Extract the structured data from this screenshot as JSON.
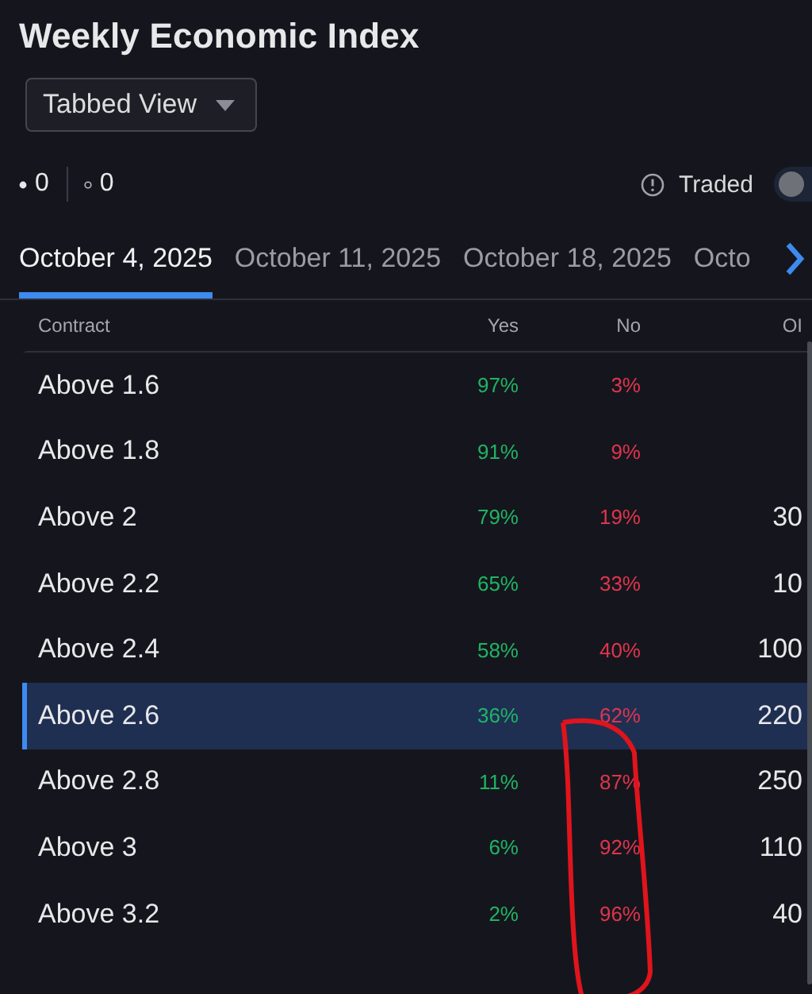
{
  "title": "Weekly Economic Index",
  "view_select": {
    "value": "Tabbed View"
  },
  "counts": [
    {
      "kind": "filled",
      "value": "0"
    },
    {
      "kind": "hollow",
      "value": "0"
    }
  ],
  "traded_toggle": {
    "label": "Traded",
    "on": false
  },
  "tabs": [
    {
      "label": "October 4, 2025",
      "selected": true
    },
    {
      "label": "October 11, 2025",
      "selected": false
    },
    {
      "label": "October 18, 2025",
      "selected": false
    },
    {
      "label": "Octo",
      "selected": false
    }
  ],
  "table": {
    "columns": [
      "Contract",
      "Yes",
      "No",
      "OI"
    ],
    "rows": [
      {
        "contract": "Above 1.6",
        "yes": "97%",
        "no": "3%",
        "selected": false
      },
      {
        "contract": "Above 1.8",
        "yes": "91%",
        "no": "9%",
        "selected": false
      },
      {
        "contract": "Above 2",
        "yes": "79%",
        "no": "19%",
        "oi": "30",
        "selected": false
      },
      {
        "contract": "Above 2.2",
        "yes": "65%",
        "no": "33%",
        "oi": "10",
        "selected": false
      },
      {
        "contract": "Above 2.4",
        "yes": "58%",
        "no": "40%",
        "oi": "100",
        "selected": false
      },
      {
        "contract": "Above 2.6",
        "yes": "36%",
        "no": "62%",
        "oi": "220",
        "selected": true
      },
      {
        "contract": "Above 2.8",
        "yes": "11%",
        "no": "87%",
        "oi": "250",
        "selected": false
      },
      {
        "contract": "Above 3",
        "yes": "6%",
        "no": "92%",
        "oi": "110",
        "selected": false
      },
      {
        "contract": "Above 3.2",
        "yes": "2%",
        "no": "96%",
        "oi": "40",
        "selected": false
      }
    ]
  }
}
